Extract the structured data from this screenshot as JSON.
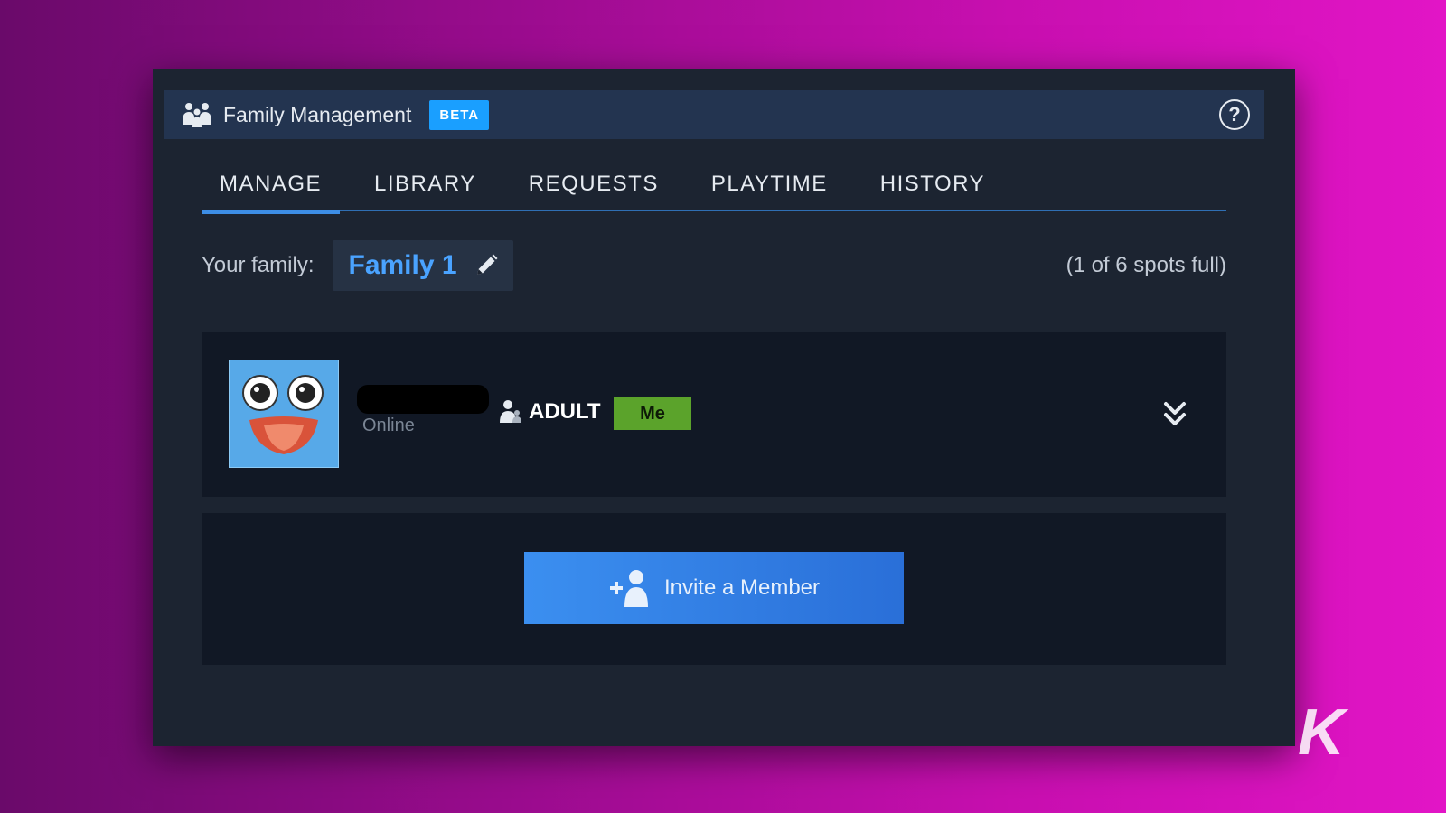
{
  "header": {
    "icon": "family-icon",
    "title": "Family Management",
    "badge": "BETA",
    "help_icon": "help-icon",
    "help_glyph": "?"
  },
  "tabs": [
    {
      "label": "MANAGE",
      "active": true
    },
    {
      "label": "LIBRARY",
      "active": false
    },
    {
      "label": "REQUESTS",
      "active": false
    },
    {
      "label": "PLAYTIME",
      "active": false
    },
    {
      "label": "HISTORY",
      "active": false
    }
  ],
  "family": {
    "label": "Your family:",
    "name": "Family 1",
    "edit_icon": "pencil-icon",
    "spots": "(1 of 6 spots full)"
  },
  "member": {
    "avatar": "avatar-googly-eyes",
    "status": "Online",
    "role_icon": "person-icon",
    "role": "ADULT",
    "badge": "Me",
    "expand_icon": "double-chevron-down-icon"
  },
  "invite": {
    "icon": "add-person-icon",
    "label": "Invite a Member"
  },
  "watermark": "K",
  "colors": {
    "accent": "#1a9fff",
    "family_name": "#4aa3ff",
    "me_badge": "#5ba32b",
    "panel": "#1c2431",
    "header": "#233450",
    "card": "#111825"
  }
}
